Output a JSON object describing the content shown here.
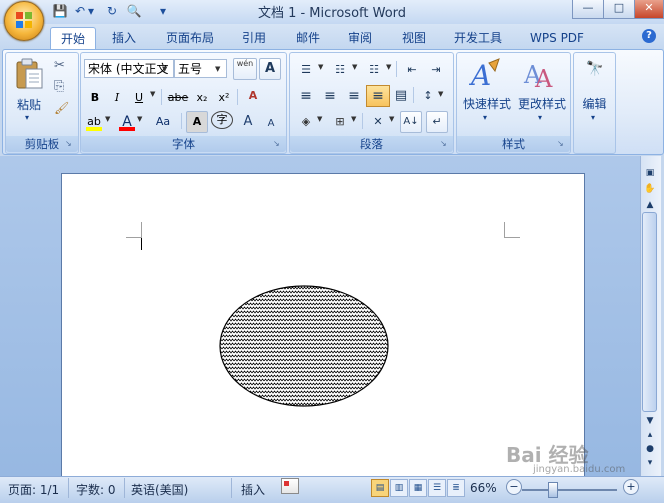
{
  "window": {
    "title": "文档 1 - Microsoft Word",
    "minimize": "—",
    "maximize": "□",
    "close": "✕"
  },
  "quick_access": {
    "save_icon": "💾",
    "undo_icon": "↶",
    "undo_dropdown": "▾",
    "redo_icon": "↻",
    "print_preview_icon": "🔍",
    "customize": "▾"
  },
  "tabs": [
    "开始",
    "插入",
    "页面布局",
    "引用",
    "邮件",
    "审阅",
    "视图",
    "开发工具",
    "WPS PDF"
  ],
  "help": "?",
  "ribbon": {
    "clipboard": {
      "paste_label": "粘贴",
      "paste_arrow": "▾",
      "cut_icon": "✂",
      "copy_icon": "⎘",
      "format_painter_icon": "🖌",
      "group_label": "剪贴板",
      "launcher": "↘"
    },
    "font": {
      "font_name": "宋体 (中文正文",
      "font_size": "五号",
      "phonetic": "wén",
      "charborder": "A",
      "bold": "B",
      "italic": "I",
      "underline": "U",
      "strike": "abe",
      "subscript": "x₂",
      "superscript": "x²",
      "clear_format": "A",
      "highlight": "ab",
      "font_color": "A",
      "change_case": "Aa",
      "char_shading": "A",
      "enclose": "字",
      "grow": "A",
      "shrink": "A",
      "group_label": "字体",
      "launcher": "↘"
    },
    "paragraph": {
      "bullets": "☰",
      "numbering": "☷",
      "multilevel": "☷",
      "decrease_indent": "⇤",
      "increase_indent": "⇥",
      "align_left": "≡",
      "center": "≡",
      "align_right": "≡",
      "justify": "≡",
      "distributed": "▤",
      "line_spacing": "↕",
      "shading": "◈",
      "borders": "⊞",
      "asian_layout": "✕",
      "sort": "A↓",
      "show_marks": "↵",
      "group_label": "段落",
      "launcher": "↘"
    },
    "styles": {
      "quick_styles": "快速样式",
      "change_styles": "更改样式",
      "group_label": "样式",
      "launcher": "↘"
    },
    "editing": {
      "label": "编辑",
      "icon": "🔭"
    }
  },
  "colors": {
    "highlight_bar": "#ffff00",
    "font_color_bar": "#ff0000"
  },
  "statusbar": {
    "page": "页面: 1/1",
    "words": "字数: 0",
    "language": "英语(美国)",
    "insert": "插入",
    "zoom": "66%",
    "zoom_out": "−",
    "zoom_in": "+"
  },
  "scrollbar": {
    "up": "▲",
    "down": "▼",
    "prev_page": "▴",
    "select_browse": "●",
    "next_page": "▾"
  },
  "watermark": {
    "text": "Bai 经验",
    "sub": "jingyan.baidu.com"
  }
}
